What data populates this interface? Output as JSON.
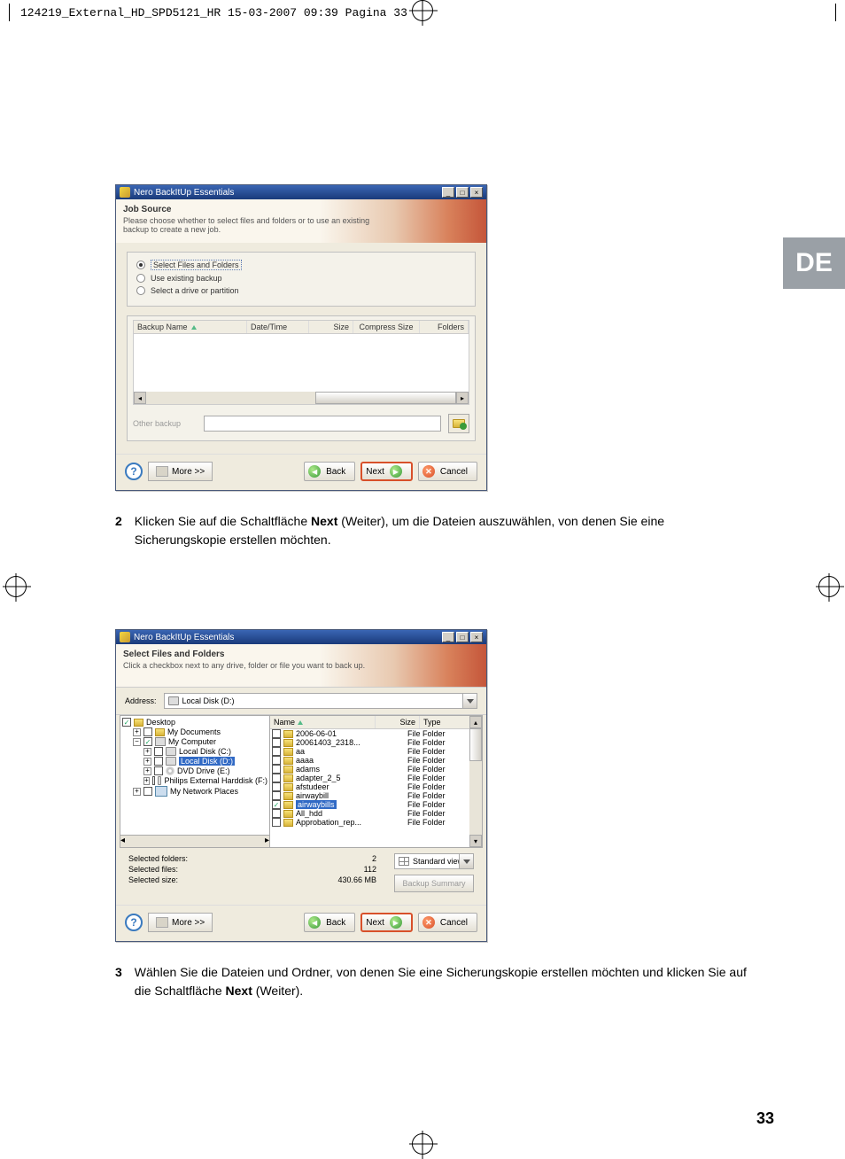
{
  "page": {
    "header": "124219_External_HD_SPD5121_HR  15-03-2007  09:39  Pagina 33",
    "lang_tab": "DE",
    "number": "33"
  },
  "win1": {
    "title": "Nero BackItUp Essentials",
    "header_title": "Job Source",
    "header_sub": "Please choose whether to select files and folders or to use an existing backup to create a new job.",
    "radios": {
      "r1": "Select Files and Folders",
      "r2": "Use existing backup",
      "r3": "Select a drive or partition"
    },
    "cols": {
      "name": "Backup Name",
      "datetime": "Date/Time",
      "size": "Size",
      "csize": "Compress Size",
      "folders": "Folders"
    },
    "other_label": "Other backup",
    "btns": {
      "more": "More >>",
      "back": "Back",
      "next": "Next",
      "cancel": "Cancel"
    }
  },
  "step2": {
    "num": "2",
    "text_before": "Klicken Sie auf die Schaltfläche ",
    "bold": "Next",
    "text_after": " (Weiter), um die Dateien auszuwählen, von denen Sie eine Sicherungskopie erstellen möchten."
  },
  "win2": {
    "title": "Nero BackItUp Essentials",
    "header_title": "Select Files and Folders",
    "header_sub": "Click a checkbox next to any drive, folder or file you want to back up.",
    "address_label": "Address:",
    "address_value": "Local Disk (D:)",
    "tree": {
      "desktop": "Desktop",
      "mydocs": "My Documents",
      "mycomp": "My Computer",
      "c": "Local Disk (C:)",
      "d": "Local Disk (D:)",
      "e": "DVD Drive (E:)",
      "f": "Philips External Harddisk (F:)",
      "net": "My Network Places"
    },
    "list_cols": {
      "name": "Name",
      "size": "Size",
      "type": "Type"
    },
    "file_type": "File Folder",
    "files": [
      "2006-06-01",
      "20061403_2318...",
      "aa",
      "aaaa",
      "adams",
      "adapter_2_5",
      "afstudeer",
      "airwaybill",
      "airwaybills",
      "All_hdd",
      "Approbation_rep..."
    ],
    "summary": {
      "folders_label": "Selected folders:",
      "folders_val": "2",
      "files_label": "Selected files:",
      "files_val": "112",
      "size_label": "Selected size:",
      "size_val": "430.66 MB",
      "view": "Standard view",
      "bsummary": "Backup Summary"
    },
    "btns": {
      "more": "More >>",
      "back": "Back",
      "next": "Next",
      "cancel": "Cancel"
    }
  },
  "step3": {
    "num": "3",
    "text_before": "Wählen Sie die Dateien und Ordner, von denen Sie eine Sicherungskopie erstellen möchten und klicken Sie auf die Schaltfläche ",
    "bold": "Next",
    "text_after": " (Weiter)."
  }
}
